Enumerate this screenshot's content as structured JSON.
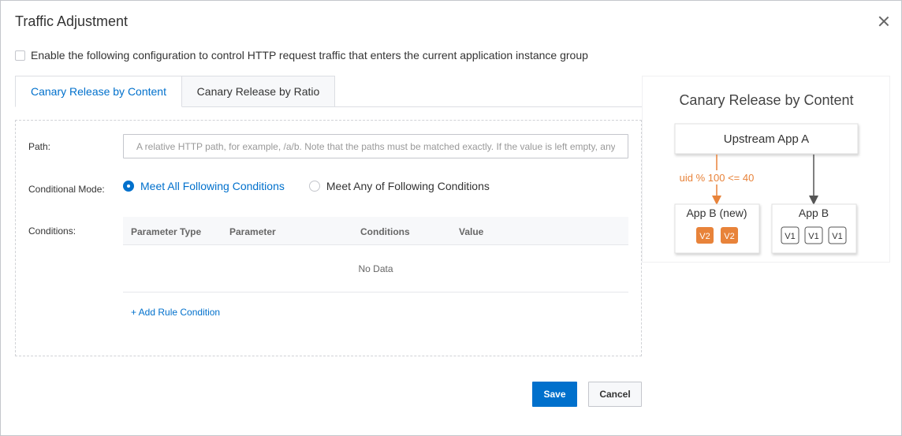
{
  "dialog": {
    "title": "Traffic Adjustment",
    "close_icon": "close-icon"
  },
  "enable": {
    "checked": false,
    "label": "Enable the following configuration to control HTTP request traffic that enters the current application instance group"
  },
  "tabs": [
    {
      "label": "Canary Release by Content",
      "active": true
    },
    {
      "label": "Canary Release by Ratio",
      "active": false
    }
  ],
  "form": {
    "path_label": "Path:",
    "path_placeholder": "A relative HTTP path, for example, /a/b. Note that the paths must be matched exactly. If the value is left empty, any",
    "path_value": "",
    "mode_label": "Conditional Mode:",
    "mode_options": [
      {
        "label": "Meet All Following Conditions",
        "selected": true
      },
      {
        "label": "Meet Any of Following Conditions",
        "selected": false
      }
    ],
    "conditions_label": "Conditions:",
    "table": {
      "columns": [
        "Parameter Type",
        "Parameter",
        "Conditions",
        "Value"
      ],
      "rows": [],
      "empty_text": "No Data"
    },
    "add_rule": "+ Add Rule Condition"
  },
  "buttons": {
    "save": "Save",
    "cancel": "Cancel"
  },
  "diagram": {
    "title": "Canary Release by Content",
    "upstream": "Upstream App A",
    "rule": "uid % 100 <= 40",
    "new_app": {
      "name": "App B (new)",
      "instances": [
        "V2",
        "V2"
      ]
    },
    "old_app": {
      "name": "App B",
      "instances": [
        "V1",
        "V1",
        "V1"
      ]
    },
    "colors": {
      "new": "#e8833a",
      "old": "#555555"
    }
  },
  "colors": {
    "accent": "#0070cc",
    "border": "#c4c6cc",
    "header_bg": "#f7f8fa"
  }
}
